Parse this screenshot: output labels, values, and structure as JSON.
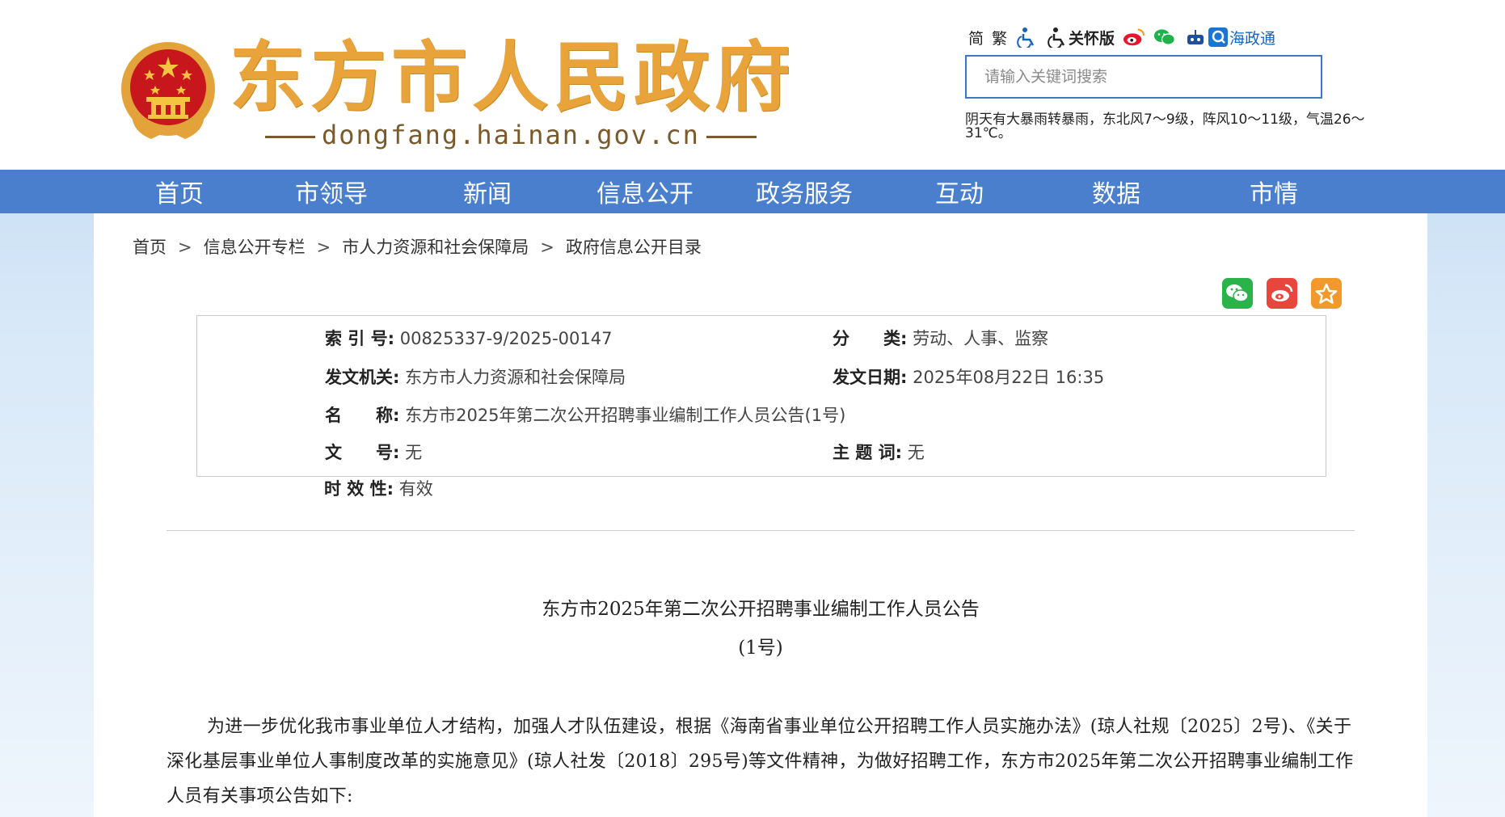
{
  "header": {
    "site_title": "东方市人民政府",
    "site_domain": "dongfang.hainan.gov.cn",
    "toolbar": {
      "simplified": "简",
      "traditional": "繁",
      "care_mode": "关怀版",
      "hai_zheng_tong": "海政通"
    },
    "search": {
      "placeholder": "请输入关键词搜索",
      "value": ""
    },
    "weather": "阴天有大暴雨转暴雨，东北风7～9级，阵风10～11级，气温26～31℃。"
  },
  "nav": {
    "items": [
      {
        "label": "首页"
      },
      {
        "label": "市领导"
      },
      {
        "label": "新闻"
      },
      {
        "label": "信息公开"
      },
      {
        "label": "政务服务"
      },
      {
        "label": "互动"
      },
      {
        "label": "数据"
      },
      {
        "label": "市情"
      }
    ]
  },
  "breadcrumb": {
    "items": [
      {
        "label": "首页"
      },
      {
        "label": "信息公开专栏"
      },
      {
        "label": "市人力资源和社会保障局"
      },
      {
        "label": "政府信息公开目录"
      }
    ],
    "separator": ">"
  },
  "share": {
    "wechat": "wechat-share-icon",
    "weibo": "weibo-share-icon",
    "favorite": "favorite-star-icon"
  },
  "meta": {
    "index_label": "索 引 号:",
    "index_value": "00825337-9/2025-00147",
    "category_label": "分　　类:",
    "category_value": "劳动、人事、监察",
    "issuer_label": "发文机关:",
    "issuer_value": "东方市人力资源和社会保障局",
    "date_label": "发文日期:",
    "date_value": "2025年08月22日 16:35",
    "name_label": "名　　称:",
    "name_value": "东方市2025年第二次公开招聘事业编制工作人员公告(1号)",
    "docno_label": "文　　号:",
    "docno_value": "无",
    "keywords_label": "主 题 词:",
    "keywords_value": "无",
    "validity_label": "时 效 性:",
    "validity_value": "有效"
  },
  "article": {
    "title": "东方市2025年第二次公开招聘事业编制工作人员公告",
    "subtitle": "(1号)",
    "body": "为进一步优化我市事业单位人才结构，加强人才队伍建设，根据《海南省事业单位公开招聘工作人员实施办法》(琼人社规〔2025〕2号)、《关于深化基层事业单位人事制度改革的实施意见》(琼人社发〔2018〕295号)等文件精神，为做好招聘工作，东方市2025年第二次公开招聘事业编制工作人员有关事项公告如下:"
  },
  "colors": {
    "nav_bg": "#4a7fce",
    "title_gold": "#e8a33b",
    "search_border": "#3d78c4"
  }
}
